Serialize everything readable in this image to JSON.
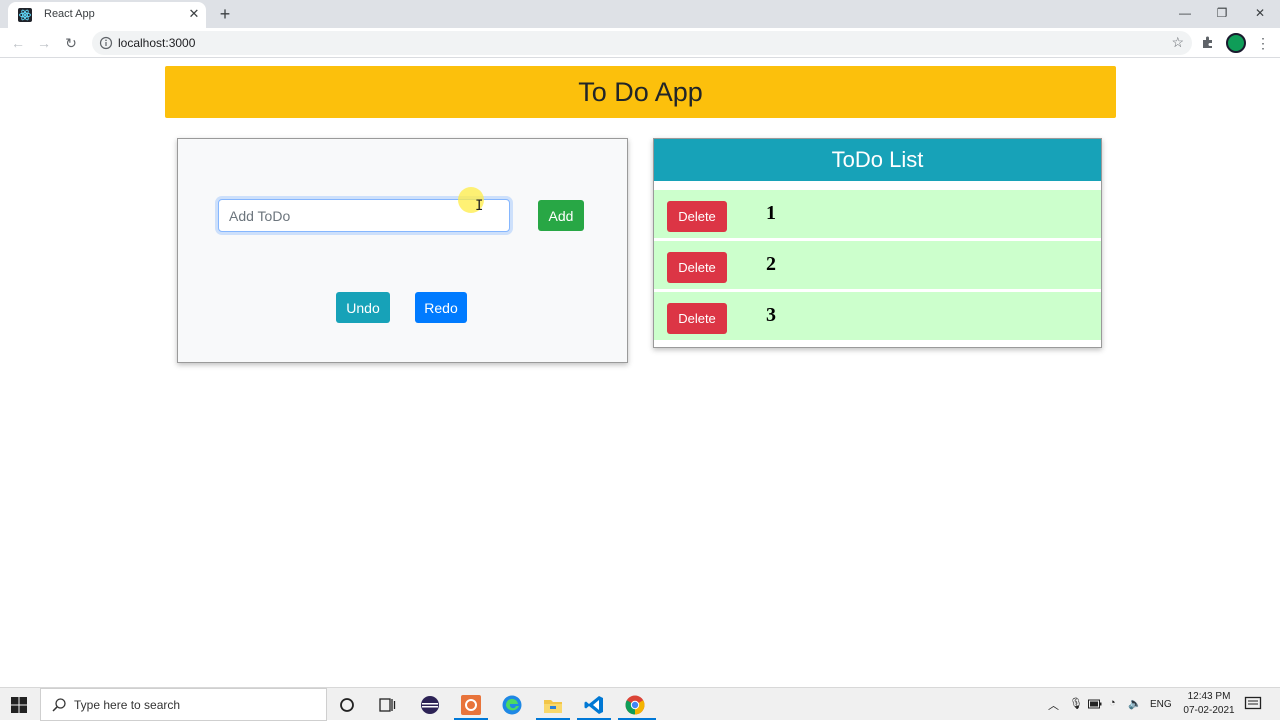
{
  "browser": {
    "tab_title": "React App",
    "url": "localhost:3000"
  },
  "app": {
    "title": "To Do App",
    "input_placeholder": "Add ToDo",
    "add_label": "Add",
    "undo_label": "Undo",
    "redo_label": "Redo",
    "list_title": "ToDo List",
    "delete_label": "Delete",
    "todos": [
      "1",
      "2",
      "3"
    ]
  },
  "colors": {
    "header_bg": "#fcc00c",
    "list_header_bg": "#17a2b8",
    "row_bg": "#ccffcc",
    "add_btn": "#28a745",
    "undo_btn": "#17a2b8",
    "redo_btn": "#007bff",
    "delete_btn": "#dc3545"
  },
  "taskbar": {
    "search_placeholder": "Type here to search",
    "lang": "ENG",
    "time": "12:43 PM",
    "date": "07-02-2021"
  }
}
